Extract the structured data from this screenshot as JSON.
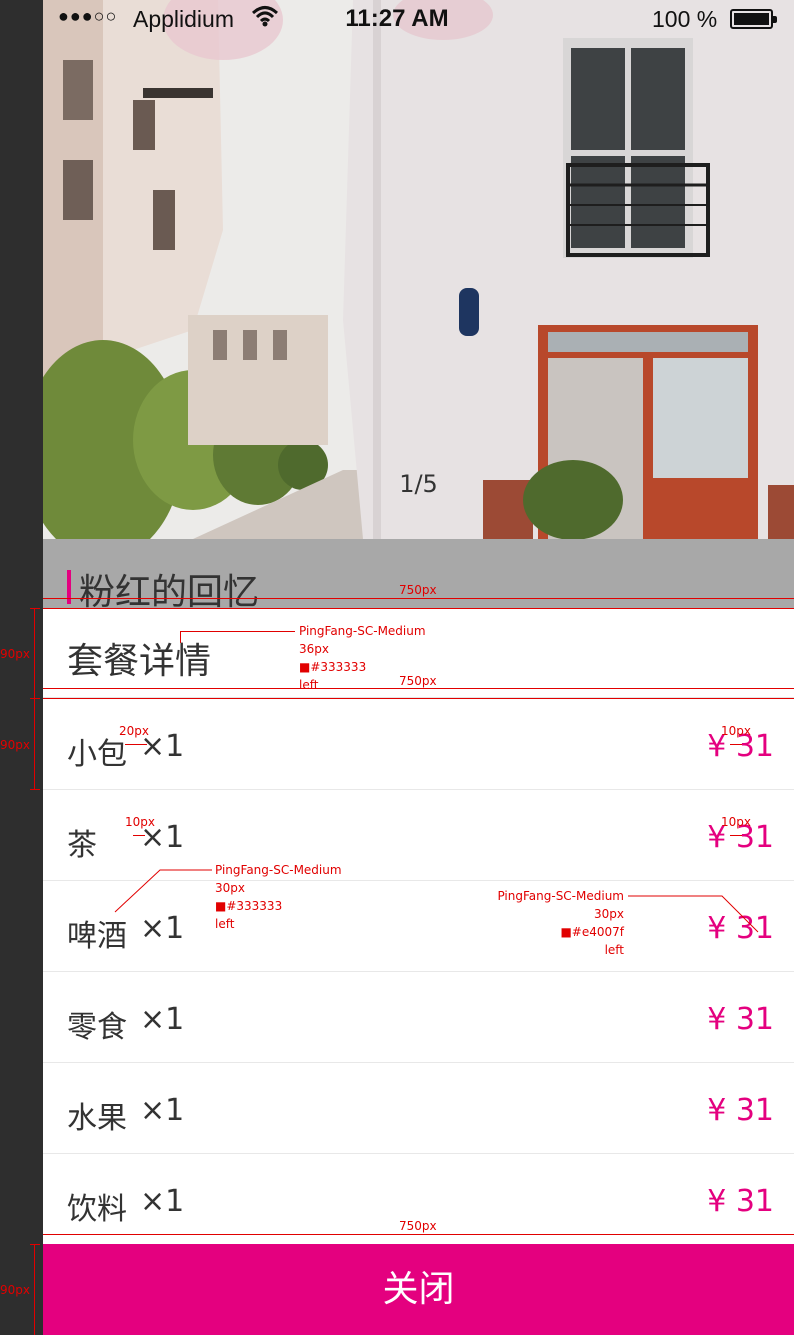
{
  "status_bar": {
    "signal": "●●●○○",
    "carrier": "Applidium",
    "time": "11:27 AM",
    "battery": "100 %"
  },
  "hero": {
    "counter": "1/5"
  },
  "title": "粉红的回忆",
  "panel": {
    "heading": "套餐详情",
    "items": [
      {
        "name": "小包",
        "qty": "×1",
        "price": "¥ 31"
      },
      {
        "name": "茶",
        "qty": "×1",
        "price": "¥ 31"
      },
      {
        "name": "啤酒",
        "qty": "×1",
        "price": "¥ 31"
      },
      {
        "name": "零食",
        "qty": "×1",
        "price": "¥ 31"
      },
      {
        "name": "水果",
        "qty": "×1",
        "price": "¥ 31"
      },
      {
        "name": "饮料",
        "qty": "×1",
        "price": "¥ 31"
      }
    ],
    "close_label": "关闭"
  },
  "annotations": {
    "width_1": "750px",
    "width_2": "750px",
    "width_3": "750px",
    "height_head": "90px",
    "height_row": "90px",
    "height_button": "90px",
    "gap_20": "20px",
    "gap_10_a": "10px",
    "gap_10_b": "10px",
    "gap_10_c": "10px",
    "spec_heading": {
      "font": "PingFang-SC-Medium",
      "size": "36px",
      "color": "■#333333",
      "align": "left"
    },
    "spec_item": {
      "font": "PingFang-SC-Medium",
      "size": "30px",
      "color": "■#333333",
      "align": "left"
    },
    "spec_price": {
      "font": "PingFang-SC-Medium",
      "size": "30px",
      "color": "■#e4007f",
      "align": "left"
    }
  },
  "colors": {
    "accent": "#e4007f",
    "text": "#333333",
    "annotation": "#e10000"
  }
}
